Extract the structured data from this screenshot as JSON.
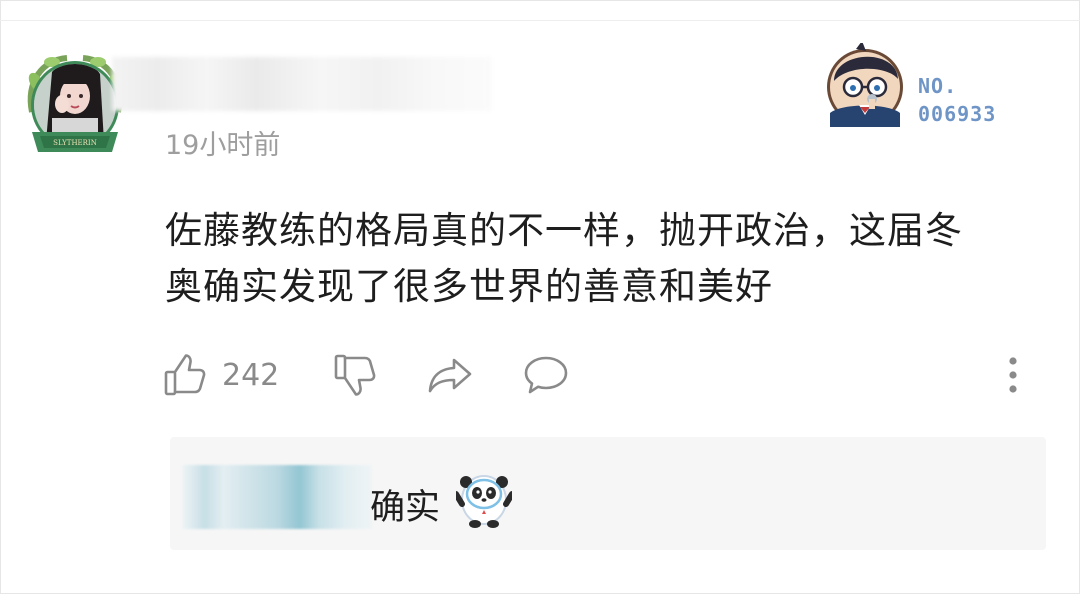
{
  "comment": {
    "timestamp": "19小时前",
    "text_line1": "佐藤教练的格局真的不一样，抛开政治，这届冬",
    "text_line2": "奥确实发现了很多世界的善意和美好",
    "avatar_badge_text": "SLYTHERIN",
    "badge": {
      "line1": "NO.",
      "line2": "006933",
      "color": "#6f95c7"
    }
  },
  "actions": {
    "like_count": "242",
    "icons": [
      "thumbs-up-icon",
      "thumbs-down-icon",
      "share-icon",
      "comment-icon",
      "more-vertical-icon"
    ]
  },
  "reply": {
    "text": "确实",
    "emoji": "bing-dwen-dwen-mascot"
  },
  "colors": {
    "text": "#1e1e1e",
    "muted": "#9e9e9e",
    "icon": "#8a8a8a",
    "reply_bg": "#f6f6f6"
  }
}
